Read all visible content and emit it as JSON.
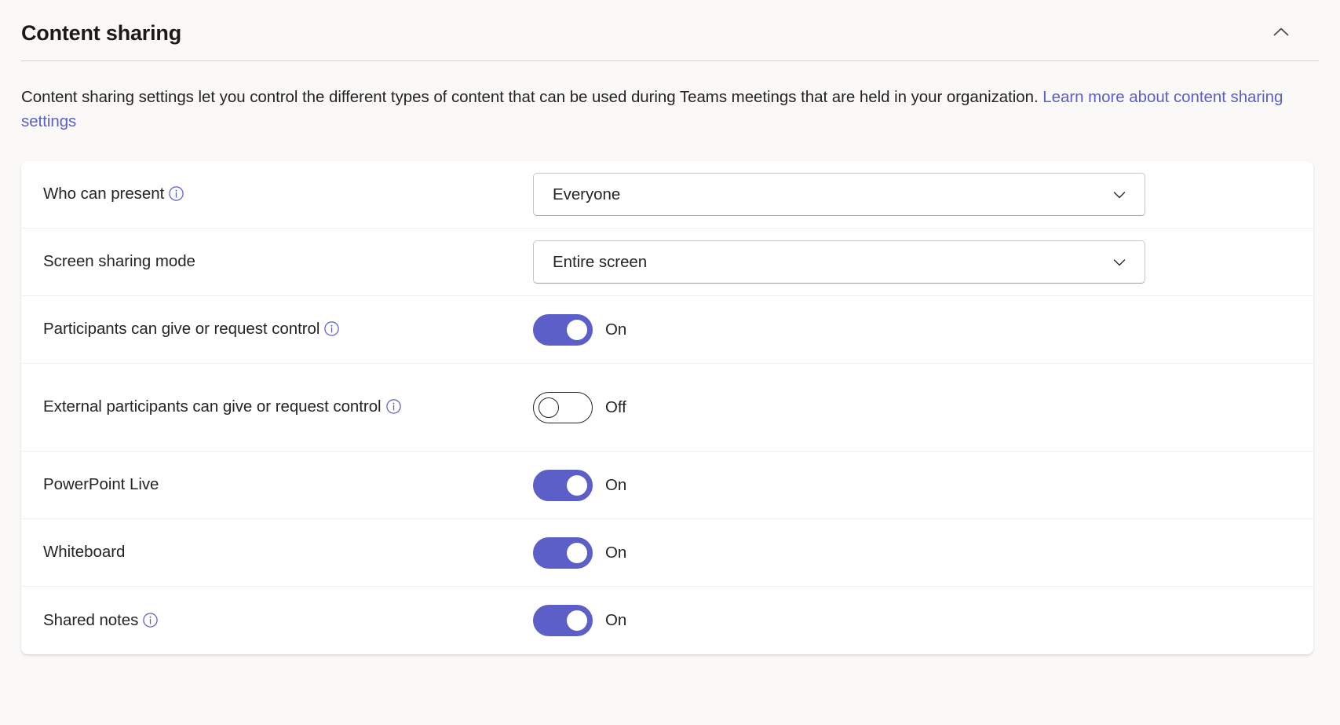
{
  "section": {
    "title": "Content sharing",
    "collapse_icon": "chevron-up-icon",
    "description_before_link": "Content sharing settings let you control the different types of content that can be used during Teams meetings that are held in your organization. ",
    "description_link": "Learn more about content sharing settings"
  },
  "colors": {
    "accent": "#5b5fc7",
    "link": "#5b5fc7",
    "page_background": "#faf9f8",
    "card_background": "#ffffff",
    "text": "#242424",
    "divider": "#d2d0ce"
  },
  "settings": [
    {
      "label": "Who can present",
      "has_info": true,
      "info_icon": "info-circle-icon",
      "control": "dropdown",
      "value": "Everyone",
      "chevron_icon": "chevron-down-icon"
    },
    {
      "label": "Screen sharing mode",
      "has_info": false,
      "control": "dropdown",
      "value": "Entire screen",
      "chevron_icon": "chevron-down-icon"
    },
    {
      "label": "Participants can give or request control",
      "has_info": true,
      "info_icon": "info-circle-icon",
      "control": "toggle",
      "state": "on",
      "value": "On"
    },
    {
      "label": "External participants can give or request control",
      "has_info": true,
      "info_icon": "info-circle-icon",
      "control": "toggle",
      "state": "off",
      "value": "Off"
    },
    {
      "label": "PowerPoint Live",
      "has_info": false,
      "control": "toggle",
      "state": "on",
      "value": "On"
    },
    {
      "label": "Whiteboard",
      "has_info": false,
      "control": "toggle",
      "state": "on",
      "value": "On"
    },
    {
      "label": "Shared notes",
      "has_info": true,
      "info_icon": "info-circle-icon",
      "control": "toggle",
      "state": "on",
      "value": "On"
    }
  ]
}
